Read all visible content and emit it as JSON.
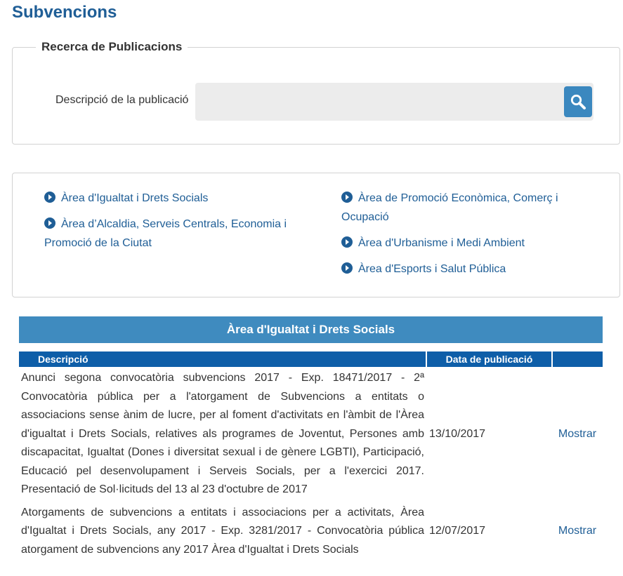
{
  "page": {
    "title": "Subvencions"
  },
  "search": {
    "legend": "Recerca de Publicacions",
    "label": "Descripció de la publicació",
    "value": "",
    "placeholder": ""
  },
  "areas": {
    "left": [
      "Àrea d'Igualtat i Drets Socials",
      "Àrea d’Alcaldia, Serveis Centrals, Economia i Promoció de la Ciutat"
    ],
    "right": [
      "Àrea de Promoció Econòmica, Comerç i Ocupació",
      "Àrea d'Urbanisme i Medi Ambient",
      "Àrea d'Esports i Salut Pública"
    ]
  },
  "results": {
    "title": "Àrea d'Igualtat i Drets Socials",
    "headers": {
      "description": "Descripció",
      "date": "Data de publicació",
      "action": ""
    },
    "rows": [
      {
        "description": "Anunci segona convocatòria subvencions 2017 - Exp. 18471/2017 - 2ª Convocatòria pública per a l'atorgament de Subvencions a entitats o associacions sense ànim de lucre, per al foment d'activitats en l'àmbit de l'Àrea d'igualtat i Drets Socials, relatives als programes de Joventut, Persones amb discapacitat, Igualtat (Dones i diversitat sexual i de gènere LGBTI), Participació, Educació pel desenvolupament i Serveis Socials, per a l'exercici 2017. Presentació de Sol·licituds del 13 al 23 d'octubre de 2017",
        "date": "13/10/2017",
        "action": "Mostrar"
      },
      {
        "description": "Atorgaments de subvencions a entitats i associacions per a activitats, Àrea d'Igualtat i Drets Socials, any 2017 - Exp. 3281/2017 - Convocatòria pública atorgament de subvencions any 2017 Àrea d'Igualtat i Drets Socials",
        "date": "12/07/2017",
        "action": "Mostrar"
      }
    ]
  },
  "icons": {
    "search": "search-icon",
    "bullet": "chevron-circle-right-icon"
  },
  "colors": {
    "brand": "#1f5e96",
    "header": "#3f8bbf",
    "table_head": "#0e5ea8",
    "search_button": "#3b88bf"
  }
}
